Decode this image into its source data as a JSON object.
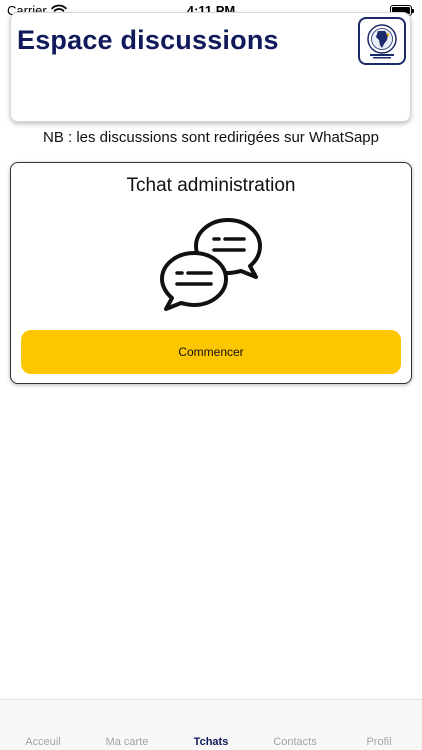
{
  "status_bar": {
    "carrier": "Carrier",
    "time": "4:11 PM"
  },
  "header": {
    "title": "Espace discussions"
  },
  "note": "NB : les discussions sont redirigées sur WhatSapp",
  "chat_card": {
    "title": "Tchat administration",
    "button_label": "Commencer"
  },
  "tabs": [
    {
      "label": "Acceuil",
      "active": false
    },
    {
      "label": "Ma carte",
      "active": false
    },
    {
      "label": "Tchats",
      "active": true
    },
    {
      "label": "Contacts",
      "active": false
    },
    {
      "label": "Profil",
      "active": false
    }
  ],
  "colors": {
    "title": "#101a5a",
    "button": "#fcc600",
    "tab_active": "#101a5a",
    "tab_inactive": "#a3a3a3"
  },
  "icons": {
    "chat": "chat-bubbles-icon",
    "wifi": "wifi-icon",
    "battery": "battery-icon",
    "logo": "app-logo-icon"
  }
}
